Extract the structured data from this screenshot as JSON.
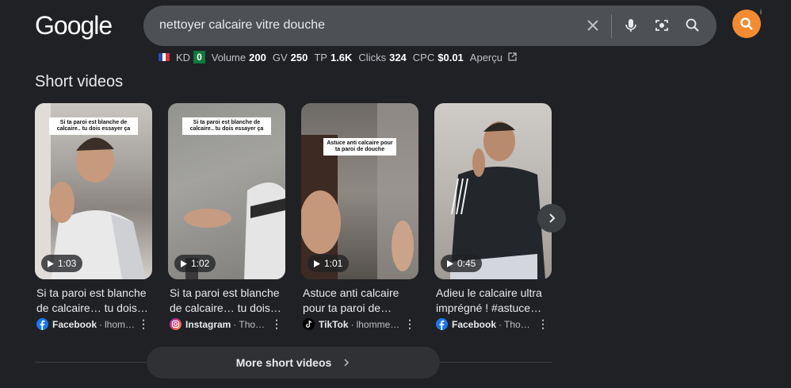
{
  "header": {
    "logo": "Google",
    "search_query": "nettoyer calcaire vitre douche",
    "info_glyph": "i"
  },
  "seo_bar": {
    "flag": "france-flag",
    "kd_label": "KD",
    "kd_value": "0",
    "volume_label": "Volume",
    "volume_value": "200",
    "gv_label": "GV",
    "gv_value": "250",
    "tp_label": "TP",
    "tp_value": "1.6K",
    "clicks_label": "Clicks",
    "clicks_value": "324",
    "cpc_label": "CPC",
    "cpc_value": "$0.01",
    "preview_label": "Aperçu"
  },
  "section": {
    "title": "Short videos"
  },
  "videos": [
    {
      "duration": "1:03",
      "overlay": "Si ta paroi est blanche de calcaire.. tu dois essayer ça",
      "title": "Si ta paroi est blanche de calcaire… tu dois…",
      "source": "Facebook",
      "author": "lhomm…",
      "icon": "facebook-icon"
    },
    {
      "duration": "1:02",
      "overlay": "Si ta paroi est blanche de calcaire.. tu dois essayer ça",
      "title": "Si ta paroi est blanche de calcaire… tu dois…",
      "source": "Instagram",
      "author": "Tho…",
      "icon": "instagram-icon"
    },
    {
      "duration": "1:01",
      "overlay": "Astuce anti calcaire pour ta paroi de douche",
      "title": "Astuce anti calcaire pour ta paroi de…",
      "source": "TikTok",
      "author": "lhomme…",
      "icon": "tiktok-icon"
    },
    {
      "duration": "0:45",
      "overlay": "",
      "title": "Adieu le calcaire ultra imprégné ! #astuce…",
      "source": "Facebook",
      "author": "Thom…",
      "icon": "facebook-icon"
    }
  ],
  "more_button": {
    "label": "More short videos"
  },
  "colors": {
    "background": "#202124",
    "search_bar": "#4d5156",
    "avatar": "#f28b31",
    "kd_badge": "#0f7a3c"
  }
}
